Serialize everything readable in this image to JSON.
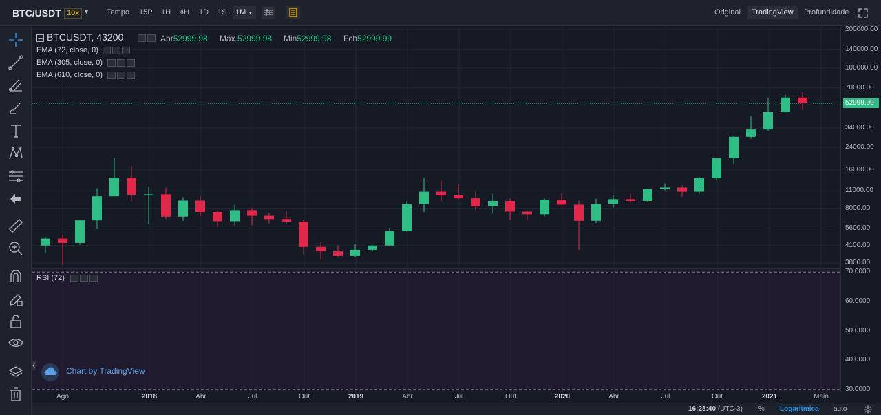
{
  "header": {
    "symbol": "BTC/USDT",
    "leverage": "10x",
    "intervals": [
      "Tempo",
      "15P",
      "1H",
      "4H",
      "1D",
      "1S",
      "1M"
    ],
    "active_interval": "1M",
    "views": [
      "Original",
      "TradingView",
      "Profundidade"
    ],
    "active_view": "TradingView"
  },
  "legend": {
    "title": "BTCUSDT, 43200",
    "ohlc": [
      {
        "label": "Abr",
        "value": "52999.98"
      },
      {
        "label": "Máx.",
        "value": "52999.98"
      },
      {
        "label": "Min",
        "value": "52999.98"
      },
      {
        "label": "Fch",
        "value": "52999.99"
      }
    ],
    "indicators": [
      "EMA (72, close, 0)",
      "EMA (305, close, 0)",
      "EMA (610, close, 0)"
    ],
    "rsi_label": "RSI (72)"
  },
  "price_axis_labels": [
    "200000.00",
    "140000.00",
    "100000.00",
    "70000.00",
    "34000.00",
    "24000.00",
    "16000.00",
    "11000.00",
    "8000.00",
    "5600.00",
    "4100.00",
    "3000.00"
  ],
  "last_price": "52999.99",
  "rsi_axis_labels": [
    "70.0000",
    "60.0000",
    "50.0000",
    "40.0000",
    "30.0000"
  ],
  "time_axis_labels": [
    {
      "text": "Ago",
      "bold": false
    },
    {
      "text": "2018",
      "bold": true
    },
    {
      "text": "Abr",
      "bold": false
    },
    {
      "text": "Jul",
      "bold": false
    },
    {
      "text": "Out",
      "bold": false
    },
    {
      "text": "2019",
      "bold": true
    },
    {
      "text": "Abr",
      "bold": false
    },
    {
      "text": "Jul",
      "bold": false
    },
    {
      "text": "Out",
      "bold": false
    },
    {
      "text": "2020",
      "bold": true
    },
    {
      "text": "Abr",
      "bold": false
    },
    {
      "text": "Jul",
      "bold": false
    },
    {
      "text": "Out",
      "bold": false
    },
    {
      "text": "2021",
      "bold": true
    },
    {
      "text": "Maio",
      "bold": false
    }
  ],
  "watermark": "Chart by TradingView",
  "bottom": {
    "time": "16:28:40",
    "timezone": "(UTC-3)",
    "percent": "%",
    "log": "Logarítmica",
    "auto": "auto"
  },
  "colors": {
    "up": "#2ebd85",
    "down": "#e0294a",
    "bg": "#161a25",
    "panel": "#1e222d",
    "rsi_bg": "#1f1a2e"
  },
  "icons": [
    "crosshair-icon",
    "trend-line-icon",
    "fib-icon",
    "brush-icon",
    "text-icon",
    "pattern-icon",
    "prediction-icon",
    "back-arrow-icon",
    "ruler-icon",
    "zoom-icon",
    "magnet-icon",
    "pencil-lock-icon",
    "lock-icon",
    "eye-icon",
    "layers-icon",
    "trash-icon",
    "settings-icon"
  ],
  "chart_data": {
    "type": "candlestick",
    "scale": "log",
    "ylim": [
      2750,
      210000
    ],
    "candles": [
      {
        "date": "2017-08",
        "o": 4100,
        "h": 4800,
        "l": 3600,
        "c": 4650
      },
      {
        "date": "2017-09",
        "o": 4650,
        "h": 4950,
        "l": 2900,
        "c": 4300
      },
      {
        "date": "2017-10",
        "o": 4300,
        "h": 6500,
        "l": 4150,
        "c": 6450
      },
      {
        "date": "2017-11",
        "o": 6450,
        "h": 11500,
        "l": 5500,
        "c": 9950
      },
      {
        "date": "2017-12",
        "o": 9950,
        "h": 19800,
        "l": 10800,
        "c": 13900
      },
      {
        "date": "2018-01",
        "o": 13900,
        "h": 17200,
        "l": 9100,
        "c": 10200
      },
      {
        "date": "2018-02",
        "o": 10200,
        "h": 11800,
        "l": 6000,
        "c": 10300
      },
      {
        "date": "2018-03",
        "o": 10300,
        "h": 11600,
        "l": 6600,
        "c": 6900
      },
      {
        "date": "2018-04",
        "o": 6900,
        "h": 9800,
        "l": 6400,
        "c": 9200
      },
      {
        "date": "2018-05",
        "o": 9200,
        "h": 10000,
        "l": 7000,
        "c": 7500
      },
      {
        "date": "2018-06",
        "o": 7500,
        "h": 7700,
        "l": 5750,
        "c": 6350
      },
      {
        "date": "2018-07",
        "o": 6350,
        "h": 8500,
        "l": 5900,
        "c": 7750
      },
      {
        "date": "2018-08",
        "o": 7750,
        "h": 8050,
        "l": 5880,
        "c": 7000
      },
      {
        "date": "2018-09",
        "o": 7000,
        "h": 7400,
        "l": 6100,
        "c": 6600
      },
      {
        "date": "2018-10",
        "o": 6600,
        "h": 7650,
        "l": 6050,
        "c": 6300
      },
      {
        "date": "2018-11",
        "o": 6300,
        "h": 6550,
        "l": 3500,
        "c": 4000
      },
      {
        "date": "2018-12",
        "o": 4000,
        "h": 4400,
        "l": 3200,
        "c": 3700
      },
      {
        "date": "2019-01",
        "o": 3700,
        "h": 4100,
        "l": 3350,
        "c": 3400
      },
      {
        "date": "2019-02",
        "o": 3400,
        "h": 4200,
        "l": 3350,
        "c": 3800
      },
      {
        "date": "2019-03",
        "o": 3800,
        "h": 4150,
        "l": 3700,
        "c": 4100
      },
      {
        "date": "2019-04",
        "o": 4100,
        "h": 5600,
        "l": 4050,
        "c": 5300
      },
      {
        "date": "2019-05",
        "o": 5300,
        "h": 9100,
        "l": 5250,
        "c": 8600
      },
      {
        "date": "2019-06",
        "o": 8600,
        "h": 13900,
        "l": 7500,
        "c": 10800
      },
      {
        "date": "2019-07",
        "o": 10800,
        "h": 13200,
        "l": 9100,
        "c": 10100
      },
      {
        "date": "2019-08",
        "o": 10100,
        "h": 12300,
        "l": 9400,
        "c": 9600
      },
      {
        "date": "2019-09",
        "o": 9600,
        "h": 10900,
        "l": 7700,
        "c": 8300
      },
      {
        "date": "2019-10",
        "o": 8300,
        "h": 10400,
        "l": 7300,
        "c": 9150
      },
      {
        "date": "2019-11",
        "o": 9150,
        "h": 9500,
        "l": 6550,
        "c": 7550
      },
      {
        "date": "2019-12",
        "o": 7550,
        "h": 7700,
        "l": 6450,
        "c": 7200
      },
      {
        "date": "2020-01",
        "o": 7200,
        "h": 9550,
        "l": 6900,
        "c": 9350
      },
      {
        "date": "2020-02",
        "o": 9350,
        "h": 10500,
        "l": 8450,
        "c": 8550
      },
      {
        "date": "2020-03",
        "o": 8550,
        "h": 9200,
        "l": 3800,
        "c": 6400
      },
      {
        "date": "2020-04",
        "o": 6400,
        "h": 9500,
        "l": 6150,
        "c": 8650
      },
      {
        "date": "2020-05",
        "o": 8650,
        "h": 10100,
        "l": 8100,
        "c": 9450
      },
      {
        "date": "2020-06",
        "o": 9450,
        "h": 10400,
        "l": 8900,
        "c": 9150
      },
      {
        "date": "2020-07",
        "o": 9150,
        "h": 11450,
        "l": 8950,
        "c": 11350
      },
      {
        "date": "2020-08",
        "o": 11350,
        "h": 12500,
        "l": 11100,
        "c": 11650
      },
      {
        "date": "2020-09",
        "o": 11650,
        "h": 12100,
        "l": 9900,
        "c": 10800
      },
      {
        "date": "2020-10",
        "o": 10800,
        "h": 14100,
        "l": 10400,
        "c": 13800
      },
      {
        "date": "2020-11",
        "o": 13800,
        "h": 19900,
        "l": 13200,
        "c": 19700
      },
      {
        "date": "2020-12",
        "o": 19700,
        "h": 29300,
        "l": 17600,
        "c": 29000
      },
      {
        "date": "2021-01",
        "o": 29000,
        "h": 42000,
        "l": 28000,
        "c": 33100
      },
      {
        "date": "2021-02",
        "o": 33100,
        "h": 58300,
        "l": 32300,
        "c": 45200
      },
      {
        "date": "2021-03",
        "o": 45200,
        "h": 61800,
        "l": 44900,
        "c": 58800
      },
      {
        "date": "2021-04",
        "o": 58800,
        "h": 64800,
        "l": 47000,
        "c": 53000
      }
    ],
    "last_price": 52999.99,
    "rsi_ylim": [
      29,
      71
    ],
    "rsi_levels": [
      70,
      30
    ]
  }
}
